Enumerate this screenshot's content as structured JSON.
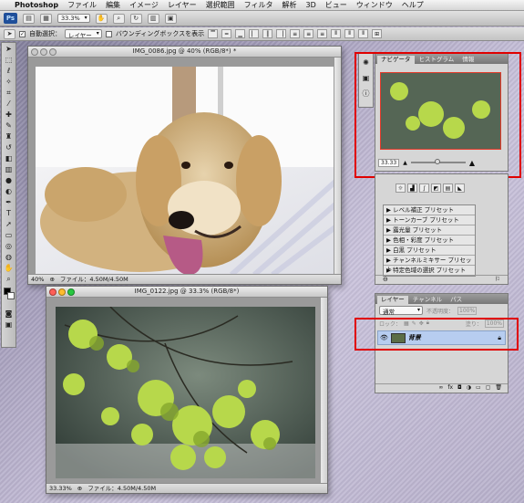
{
  "menubar": {
    "apple": "",
    "app_name": "Photoshop",
    "items": [
      "ファイル",
      "編集",
      "イメージ",
      "レイヤー",
      "選択範囲",
      "フィルタ",
      "解析",
      "3D",
      "ビュー",
      "ウィンドウ",
      "ヘルプ"
    ]
  },
  "appbar": {
    "ps_badge": "Ps",
    "zoom_value": "33.3%"
  },
  "options_bar": {
    "auto_select_label": "自動選択：",
    "auto_select_value": "レイヤー",
    "bounding_box_label": "バウンディングボックスを表示"
  },
  "doc1": {
    "title": "IMG_0086.jpg @ 40% (RGB/8*) *",
    "zoom": "40%",
    "file_info": "ファイル：4.50M/4.50M"
  },
  "doc2": {
    "title": "IMG_0122.jpg @ 33.3% (RGB/8*)",
    "zoom": "33.33%",
    "file_info": "ファイル：4.50M/4.50M"
  },
  "navigator": {
    "tabs": [
      "ナビゲータ",
      "ヒストグラム",
      "情報"
    ],
    "zoom": "33.33"
  },
  "adjustments": {
    "presets": [
      "レベル補正 プリセット",
      "トーンカーブ プリセット",
      "露光量 プリセット",
      "色相・彩度 プリセット",
      "白黒 プリセット",
      "チャンネルミキサー プリセット",
      "特定色域の選択 プリセット"
    ]
  },
  "layers": {
    "tabs": [
      "レイヤー",
      "チャンネル",
      "パス"
    ],
    "blend_mode": "通常",
    "opacity_label": "不透明度：",
    "opacity_value": "100%",
    "lock_label": "ロック：",
    "fill_label": "塗り：",
    "fill_value": "100%",
    "layer_name": "背景"
  },
  "colors": {
    "highlight": "#e00000",
    "ps_badge": "#1f4f9a",
    "selected_layer": "#b7cdf0"
  }
}
